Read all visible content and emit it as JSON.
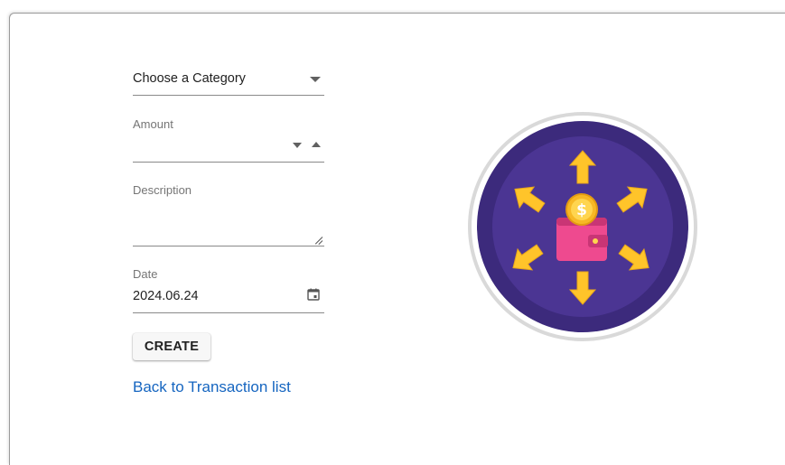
{
  "form": {
    "category": {
      "value": "Choose a Category",
      "icon": "chevron-down-icon"
    },
    "amount": {
      "label": "Amount",
      "value": ""
    },
    "description": {
      "label": "Description",
      "value": ""
    },
    "date": {
      "label": "Date",
      "value": "2024.06.24",
      "icon": "calendar-icon"
    },
    "create_label": "CREATE",
    "back_link": "Back to Transaction list"
  },
  "illustration": {
    "name": "wallet-money-arrows-illustration",
    "coin_symbol": "$",
    "colors": {
      "outer_ring": "#ffffff",
      "circle_dark": "#3c2a7c",
      "circle_inner": "#4b3593",
      "arrows": "#ffc42a",
      "wallet": "#ee4a8f",
      "coin": "#f7b825"
    }
  },
  "colors": {
    "link": "#1565c0",
    "underline": "#8a8a8a",
    "label": "#757575"
  }
}
